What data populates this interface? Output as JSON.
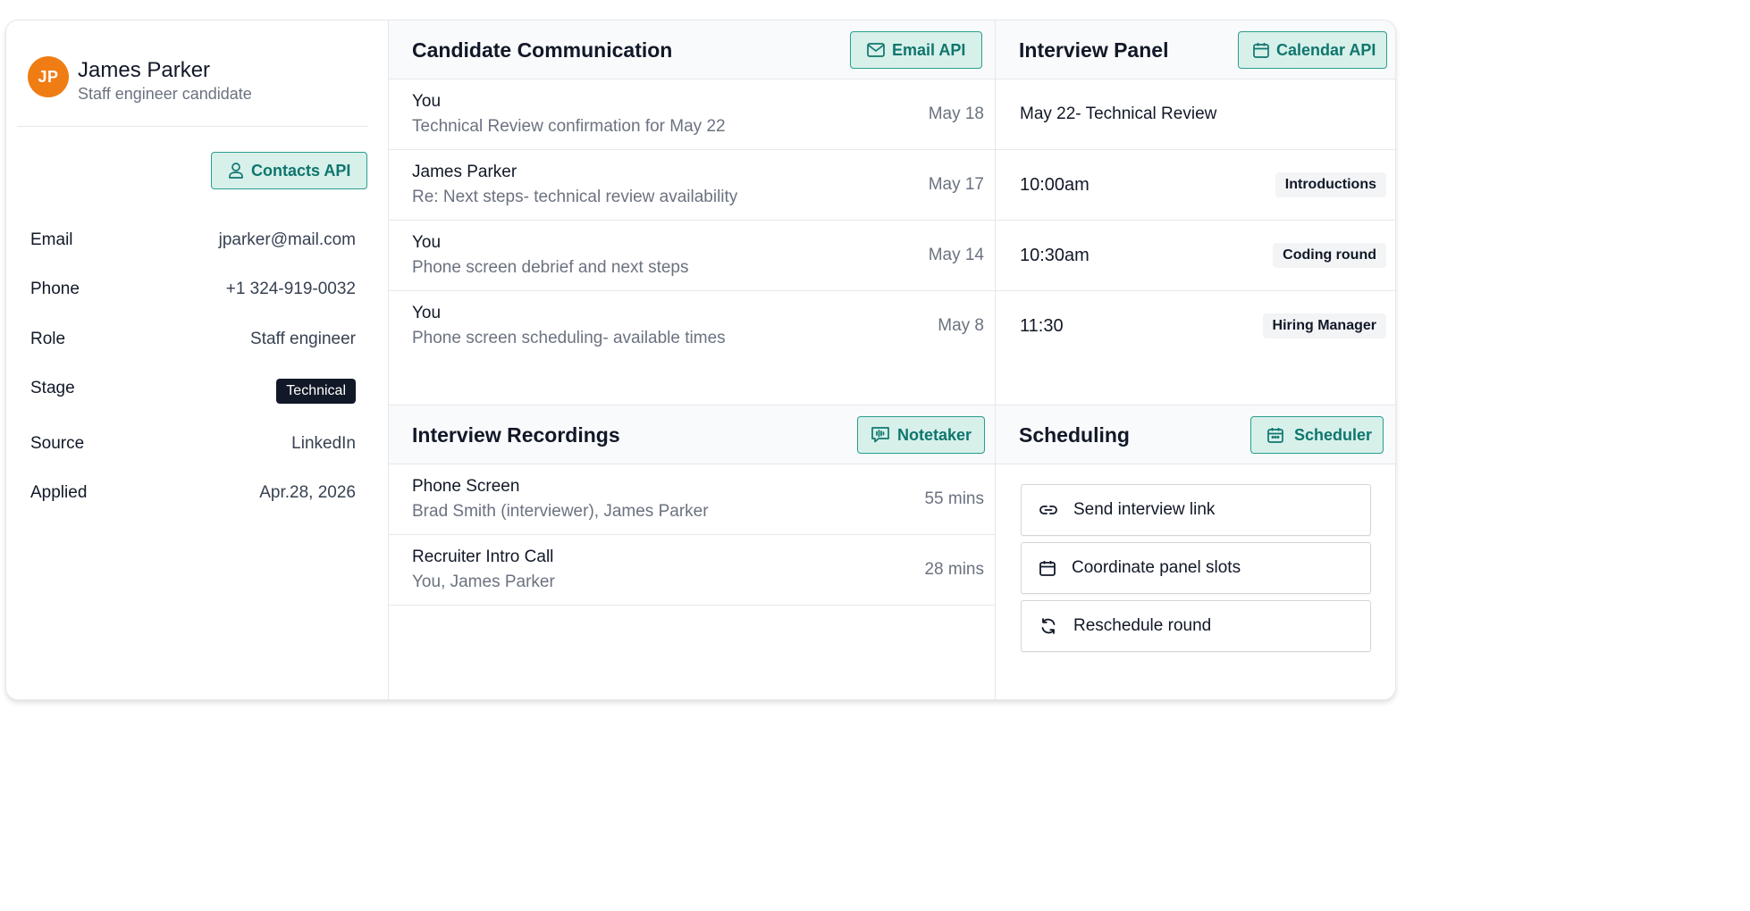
{
  "candidate": {
    "initials": "JP",
    "name": "James Parker",
    "subtitle": "Staff engineer candidate",
    "contacts_api_label": "Contacts API",
    "fields": [
      {
        "label": "Email",
        "value": "jparker@mail.com"
      },
      {
        "label": "Phone",
        "value": "+1 324-919-0032"
      },
      {
        "label": "Role",
        "value": "Staff engineer"
      },
      {
        "label": "Stage",
        "value": "Technical"
      },
      {
        "label": "Source",
        "value": "LinkedIn"
      },
      {
        "label": "Applied",
        "value": "Apr.28, 2026"
      }
    ]
  },
  "communication": {
    "title": "Candidate Communication",
    "api_label": "Email API",
    "messages": [
      {
        "from": "You",
        "subject": "Technical Review confirmation for May 22",
        "date": "May 18"
      },
      {
        "from": "James Parker",
        "subject": "Re: Next steps- technical review availability",
        "date": "May 17"
      },
      {
        "from": "You",
        "subject": "Phone screen debrief and next steps",
        "date": "May 14"
      },
      {
        "from": "You",
        "subject": "Phone screen scheduling- available times",
        "date": "May 8"
      }
    ]
  },
  "interview_panel": {
    "title": "Interview Panel",
    "api_label": "Calendar API",
    "event_title": "May 22- Technical Review",
    "slots": [
      {
        "time": "10:00am",
        "tag": "Introductions"
      },
      {
        "time": "10:30am",
        "tag": "Coding round"
      },
      {
        "time": "11:30",
        "tag": "Hiring Manager"
      }
    ]
  },
  "recordings": {
    "title": "Interview Recordings",
    "api_label": "Notetaker",
    "items": [
      {
        "title": "Phone Screen",
        "participants": "Brad Smith (interviewer), James Parker",
        "duration": "55 mins"
      },
      {
        "title": "Recruiter Intro Call",
        "participants": "You, James Parker",
        "duration": "28 mins"
      }
    ]
  },
  "scheduling": {
    "title": "Scheduling",
    "api_label": "Scheduler",
    "actions": [
      {
        "label": "Send interview link",
        "icon": "link-icon"
      },
      {
        "label": "Coordinate panel slots",
        "icon": "calendar-icon"
      },
      {
        "label": "Reschedule round",
        "icon": "refresh-icon"
      }
    ]
  },
  "colors": {
    "accent": "#0f766e",
    "accent_bg": "#d7f0ea",
    "avatar": "#ef7d13",
    "stage_badge": "#111827"
  }
}
